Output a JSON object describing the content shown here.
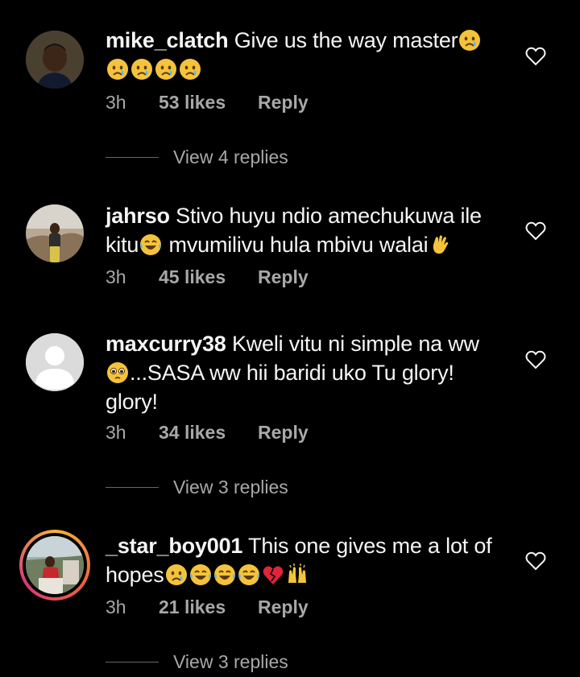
{
  "comments": [
    {
      "username": "mike_clatch",
      "text_a": "Give us the way master",
      "text_b": "",
      "time": "3h",
      "likes": "53 likes",
      "reply": "Reply",
      "view_replies": "View 4 replies",
      "avatar": "person-photo"
    },
    {
      "username": "jahrso",
      "text_a": "Stivo huyu ndio amechukuwa ile",
      "text_b": "kitu",
      "text_c": "mvumilivu hula mbivu walai",
      "time": "3h",
      "likes": "45 likes",
      "reply": "Reply",
      "avatar": "person-photo"
    },
    {
      "username": "maxcurry38",
      "text_a": "Kweli vitu ni simple na ww",
      "text_b": "...SASA ww hii baridi uko Tu glory!",
      "text_c": "glory!",
      "time": "3h",
      "likes": "34 likes",
      "reply": "Reply",
      "view_replies": "View 3 replies",
      "avatar": "default-avatar"
    },
    {
      "username": "_star_boy001",
      "text_a": "This one gives me a lot of",
      "text_b": "hopes",
      "time": "3h",
      "likes": "21 likes",
      "reply": "Reply",
      "view_replies": "View 3 replies",
      "avatar": "story-ring-avatar"
    }
  ],
  "icons": {
    "like": "heart-outline-icon"
  },
  "colors": {
    "background": "#000000",
    "text": "#f5f5f5",
    "secondary": "#a8a8a8",
    "ring": "#f0633c"
  }
}
